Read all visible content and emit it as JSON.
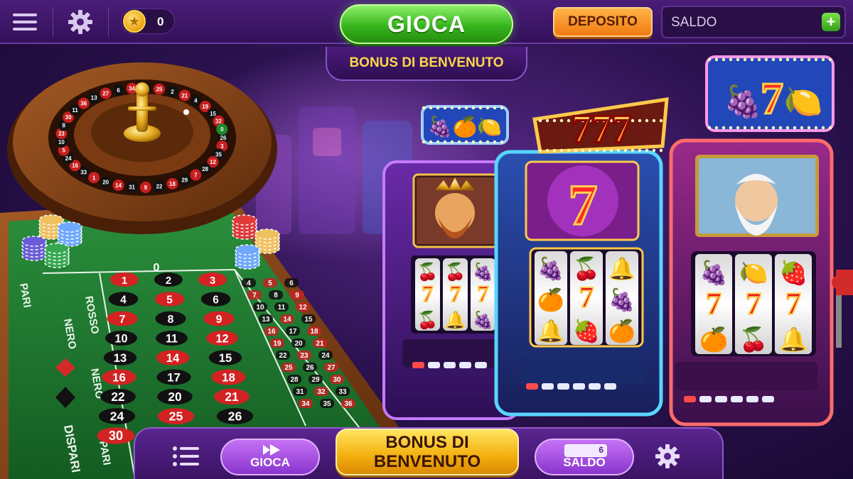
{
  "header": {
    "coins": "0",
    "play_label": "GIOCA",
    "bonus_tab_label": "BONUS DI BENVENUTO",
    "deposit_label": "DEPOSITO",
    "balance_label": "SALDO",
    "add_funds_symbol": "+"
  },
  "roulette": {
    "layout": {
      "zero": "0",
      "left_labels": [
        "PARI",
        "NERO",
        "ROSSO",
        "NERO"
      ],
      "bottom_labels": [
        "DISPARI",
        "PARI"
      ],
      "rows": [
        [
          "1",
          "2",
          "3"
        ],
        [
          "4",
          "5",
          "6"
        ],
        [
          "7",
          "8",
          "9"
        ],
        [
          "10",
          "11",
          "12"
        ],
        [
          "13",
          "14",
          "15"
        ],
        [
          "16",
          "17",
          "18"
        ],
        [
          "22",
          "20",
          "21"
        ],
        [
          "24",
          "25",
          "26"
        ],
        [
          "30"
        ]
      ],
      "side_numbers": [
        "4",
        "7",
        "10",
        "13",
        "16",
        "19",
        "22",
        "25",
        "28",
        "31",
        "34",
        "5",
        "8",
        "11",
        "14",
        "17",
        "20",
        "23",
        "26",
        "29",
        "32",
        "35",
        "6",
        "9",
        "12",
        "15",
        "18",
        "21",
        "24",
        "27",
        "30",
        "33",
        "36"
      ]
    },
    "wheel_numbers": [
      "26",
      "3",
      "35",
      "12",
      "28",
      "7",
      "29",
      "18",
      "22",
      "9",
      "31",
      "14",
      "20",
      "1",
      "33",
      "16",
      "24",
      "5",
      "10",
      "23",
      "8",
      "30",
      "11",
      "36",
      "13",
      "27",
      "6",
      "34",
      "17",
      "25",
      "2",
      "21",
      "4",
      "19",
      "15",
      "32",
      "0"
    ]
  },
  "slots": [
    {
      "topper": "fruits",
      "screen": "king",
      "reels": [
        "🍒",
        "🍒",
        "🍇",
        "7",
        "7",
        "7",
        "🍒",
        "🔔",
        "🍇"
      ]
    },
    {
      "topper": "777",
      "screen": "seven",
      "reels": [
        "🍇",
        "🍒",
        "🔔",
        "🍊",
        "7",
        "🍇",
        "🔔",
        "🍓",
        "🍊"
      ]
    },
    {
      "topper": "fruit-seven",
      "screen": "zeus",
      "reels": [
        "🍇",
        "🍋",
        "🍓",
        "7",
        "7",
        "7",
        "🍊",
        "🍒",
        "🔔"
      ]
    }
  ],
  "footer": {
    "play_label": "GIOCA",
    "bonus_label_line1": "BONUS DI",
    "bonus_label_line2": "BENVENUTO",
    "balance_label": "SALDO",
    "balance_badge": "6"
  },
  "icons": [
    "menu-icon",
    "gear-icon",
    "star-coin-icon",
    "plus-icon",
    "play-icon",
    "list-icon",
    "wallet-icon"
  ],
  "colors": {
    "play_green": "#37b51d",
    "deposit_orange": "#f07a13",
    "bonus_gold": "#f3ae0e",
    "purple": "#3a1363",
    "felt_green": "#1d7a2f"
  }
}
